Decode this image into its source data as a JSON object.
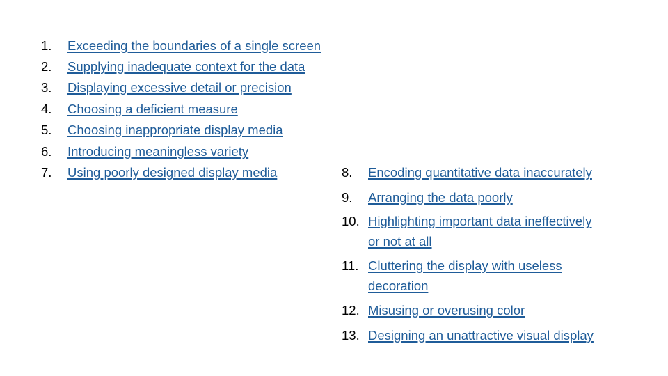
{
  "left_list": [
    {
      "number": "1.",
      "text": "Exceeding the boundaries of a single screen"
    },
    {
      "number": "2.",
      "text": "Supplying inadequate context for the data"
    },
    {
      "number": "3.",
      "text": "Displaying excessive detail or precision"
    },
    {
      "number": "4.",
      "text": "Choosing a deficient measure"
    },
    {
      "number": "5.",
      "text": "Choosing inappropriate display media"
    },
    {
      "number": "6.",
      "text": "Introducing meaningless variety"
    },
    {
      "number": "7.",
      "text": "Using poorly designed display media"
    }
  ],
  "right_list": [
    {
      "number": "8.",
      "text": "Encoding quantitative data inaccurately"
    },
    {
      "number": "9.",
      "text": "Arranging the data poorly"
    },
    {
      "number": "10.",
      "text": "Highlighting important data ineffectively",
      "text2": "or not at all"
    },
    {
      "number": "11.",
      "text": "Cluttering the display with useless",
      "text2": "decoration"
    },
    {
      "number": "12.",
      "text": "Misusing or overusing color"
    },
    {
      "number": "13.",
      "text": "Designing an unattractive visual display"
    }
  ],
  "colors": {
    "link": "#1f5c99",
    "number": "#000000",
    "background": "#ffffff"
  }
}
